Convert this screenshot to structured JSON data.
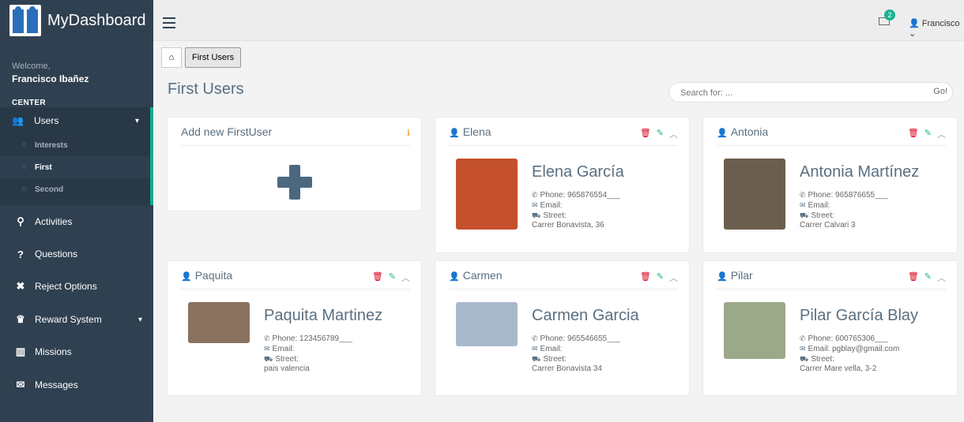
{
  "app": {
    "title": "MyDashboard"
  },
  "sidebar": {
    "welcome": "Welcome,",
    "user": "Francisco Ibañez",
    "section": "CENTER",
    "users_label": "Users",
    "subitems": [
      "Interests",
      "First",
      "Second"
    ],
    "items": [
      {
        "label": "Activities",
        "icon": "bicycle-icon"
      },
      {
        "label": "Questions",
        "icon": "question-icon"
      },
      {
        "label": "Reject Options",
        "icon": "close-icon"
      },
      {
        "label": "Reward System",
        "icon": "trophy-icon"
      },
      {
        "label": "Missions",
        "icon": "map-icon"
      },
      {
        "label": "Messages",
        "icon": "envelope-icon"
      }
    ]
  },
  "topbar": {
    "mail_count": "2",
    "user": "Francisco"
  },
  "breadcrumb": {
    "current": "First Users"
  },
  "page": {
    "title": "First Users"
  },
  "search": {
    "placeholder": "Search for: ...",
    "button": "Go!"
  },
  "add_card": {
    "title": "Add new FirstUser"
  },
  "labels": {
    "phone": "Phone:",
    "email": "Email:",
    "street": "Street:"
  },
  "users": [
    {
      "short": "Elena",
      "name": "Elena García",
      "phone": "965876554___",
      "email": "",
      "street": "Carrer Bonavista, 36",
      "photo_color": "#c4502c"
    },
    {
      "short": "Antonia",
      "name": "Antonia Martínez",
      "phone": "965876655___",
      "email": "",
      "street": "Carrer Calvari 3",
      "photo_color": "#6b5e4e"
    },
    {
      "short": "Paquita",
      "name": "Paquita Martinez",
      "phone": "123456789___",
      "email": "",
      "street": "pais valencia",
      "photo_color": "#8a7260"
    },
    {
      "short": "Carmen",
      "name": "Carmen Garcia",
      "phone": "965546655___",
      "email": "",
      "street": "Carrer Bonavista 34",
      "photo_color": "#a9b9cc"
    },
    {
      "short": "Pilar",
      "name": "Pilar García Blay",
      "phone": "600765306___",
      "email": "pgblay@gmail.com",
      "street": "Carrer Mare vella, 3-2",
      "photo_color": "#9ba988"
    }
  ]
}
